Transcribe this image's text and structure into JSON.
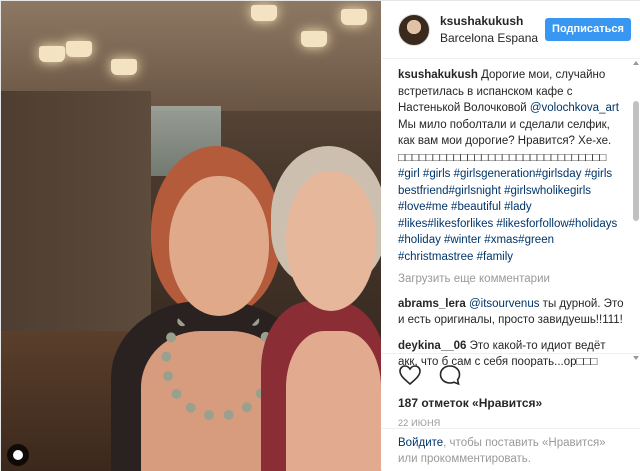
{
  "post": {
    "author": {
      "username": "ksushakukush",
      "location": "Barcelona Espana",
      "follow_label": "Подписаться"
    },
    "caption": {
      "username": "ksushakukush",
      "text_before_mention": "Дорогие мои, случайно встретилась в испанском кафе с Настенькой Волочковой",
      "mention": "@volochkova_art",
      "text_after_mention": "Мы мило поболтали и сделали селфик, как вам мои дорогие? Нравится? Хе-хе. □□□□□□□□□□□□□□□□□□□□□□□□□□□□□□",
      "hashtags": "#girl #girls #girlsgeneration#girlsday #girls bestfriend#girlsnight #girlswholikegirls #love#me #beautiful #lady #likes#likesforlikes #likesforfollow#holidays #holiday #winter #xmas#green #christmastree #family"
    },
    "load_more_label": "Загрузить еще комментарии",
    "comments": [
      {
        "username": "abrams_lera",
        "mention": "@itsourvenus",
        "text": "ты дурной. Это и есть оригиналы, просто завидуешь!!111!"
      },
      {
        "username": "deykina__06",
        "mention": "",
        "text": "Это какой-то идиот ведёт акк, что б сам с себя поорать...ор□□□"
      }
    ],
    "likes_label": "187 отметок «Нравится»",
    "date_label": "22 июня",
    "footer": {
      "login_link": "Войдите",
      "text": ", чтобы поставить «Нравится» или прокомментировать."
    },
    "icons": {
      "like": "heart-icon",
      "comment": "comment-icon",
      "more": "more-icon",
      "photo": "photo-indicator-icon"
    },
    "colors": {
      "follow_button": "#3897f0",
      "link": "#003569",
      "muted": "#999999"
    }
  }
}
